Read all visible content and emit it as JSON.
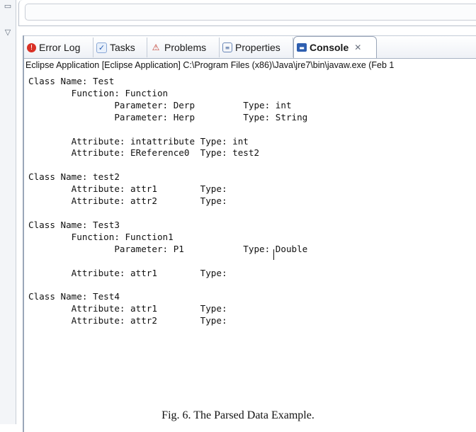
{
  "window": {
    "restore_glyph": "▭",
    "minimize_glyph": "▽"
  },
  "tabs": [
    {
      "label": "Error Log",
      "icon": "error-log-icon",
      "glyph": "!"
    },
    {
      "label": "Tasks",
      "icon": "tasks-icon",
      "glyph": "✓"
    },
    {
      "label": "Problems",
      "icon": "problems-icon",
      "glyph": "⚠"
    },
    {
      "label": "Properties",
      "icon": "properties-icon",
      "glyph": "≡"
    },
    {
      "label": "Console",
      "icon": "console-icon",
      "glyph": "▬",
      "close": "✕",
      "active": true
    }
  ],
  "console": {
    "launch_info": "Eclipse Application [Eclipse Application] C:\\Program Files (x86)\\Java\\jre7\\bin\\javaw.exe (Feb 1",
    "output": "Class Name: Test\n        Function: Function\n                Parameter: Derp         Type: int\n                Parameter: Herp         Type: String\n\n        Attribute: intattribute Type: int\n        Attribute: EReference0  Type: test2\n\nClass Name: test2\n        Attribute: attr1        Type:\n        Attribute: attr2        Type: \n\nClass Name: Test3\n        Function: Function1\n                Parameter: P1           Type: Double\n\n        Attribute: attr1        Type:\n\nClass Name: Test4\n        Attribute: attr1        Type:\n        Attribute: attr2        Type:"
  },
  "caption": "Fig. 6.   The Parsed Data Example.",
  "colors": {
    "active_tab_border": "#9aa6b8",
    "error_icon": "#d93025",
    "console_icon": "#2f5fb0"
  }
}
